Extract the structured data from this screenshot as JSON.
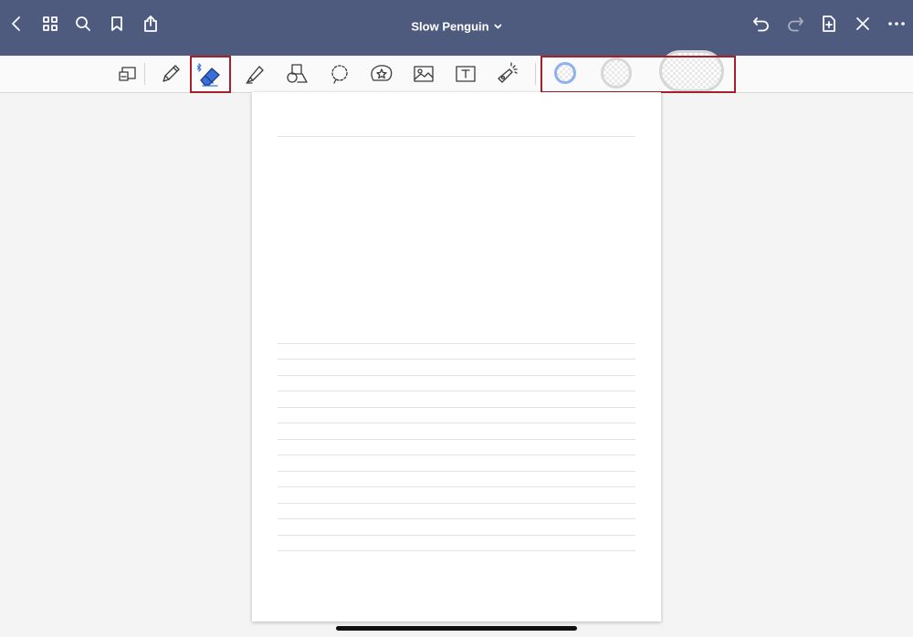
{
  "navbar": {
    "title": "Slow Penguin",
    "background": "#4f5b7e",
    "left_icons": [
      "back-icon",
      "grid-icon",
      "search-icon",
      "bookmark-icon",
      "share-icon"
    ],
    "right_icons": [
      "undo-icon",
      "redo-icon",
      "add-page-icon",
      "close-icon",
      "more-icon"
    ]
  },
  "toolbar": {
    "tools": [
      {
        "name": "zoom-window",
        "icon": "zoom-window-icon"
      },
      {
        "name": "pen",
        "icon": "pen-icon"
      },
      {
        "name": "eraser",
        "icon": "eraser-icon",
        "selected": true,
        "bluetooth": true
      },
      {
        "name": "highlighter",
        "icon": "highlighter-icon"
      },
      {
        "name": "shapes",
        "icon": "shapes-icon"
      },
      {
        "name": "lasso",
        "icon": "lasso-icon"
      },
      {
        "name": "elements",
        "icon": "sticker-icon"
      },
      {
        "name": "image",
        "icon": "image-icon"
      },
      {
        "name": "text",
        "icon": "text-box-icon"
      },
      {
        "name": "laser-pointer",
        "icon": "laser-pointer-icon"
      }
    ],
    "eraser_sizes": [
      "small",
      "medium",
      "large"
    ],
    "selected_eraser_size": "small",
    "accent_color": "#3a6fd8",
    "highlight_color": "#a5202a"
  },
  "page": {
    "template": "lined",
    "background": "#ffffff"
  }
}
